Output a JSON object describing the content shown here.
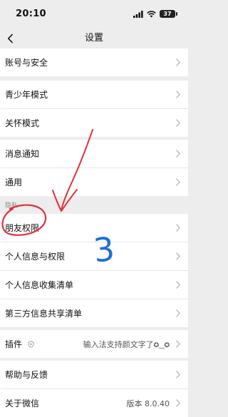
{
  "status_bar": {
    "time": "20:10",
    "battery": "37"
  },
  "nav": {
    "title": "设置"
  },
  "rows": {
    "account_security": "账号与安全",
    "teen_mode": "青少年模式",
    "care_mode": "关怀模式",
    "notifications": "消息通知",
    "general": "通用",
    "friend_permissions": "朋友权限",
    "personal_info_permissions": "个人信息与权限",
    "personal_info_collection": "个人信息收集清单",
    "third_party_sharing": "第三方信息共享清单",
    "plugins": "插件",
    "plugins_value": "输入法支持颜文字了",
    "plugins_emoticon": "✪‿✪",
    "help_feedback": "帮助与反馈",
    "about_wechat": "关于微信",
    "about_value": "版本 8.0.40"
  },
  "sections": {
    "privacy": "隐私"
  },
  "annotation": {
    "number": "3",
    "color": "#e0313a",
    "number_color": "#1f6fd6"
  },
  "icons": {
    "back": "chevron-left-icon",
    "row": "chevron-right-icon",
    "plugin": "shield-icon"
  }
}
